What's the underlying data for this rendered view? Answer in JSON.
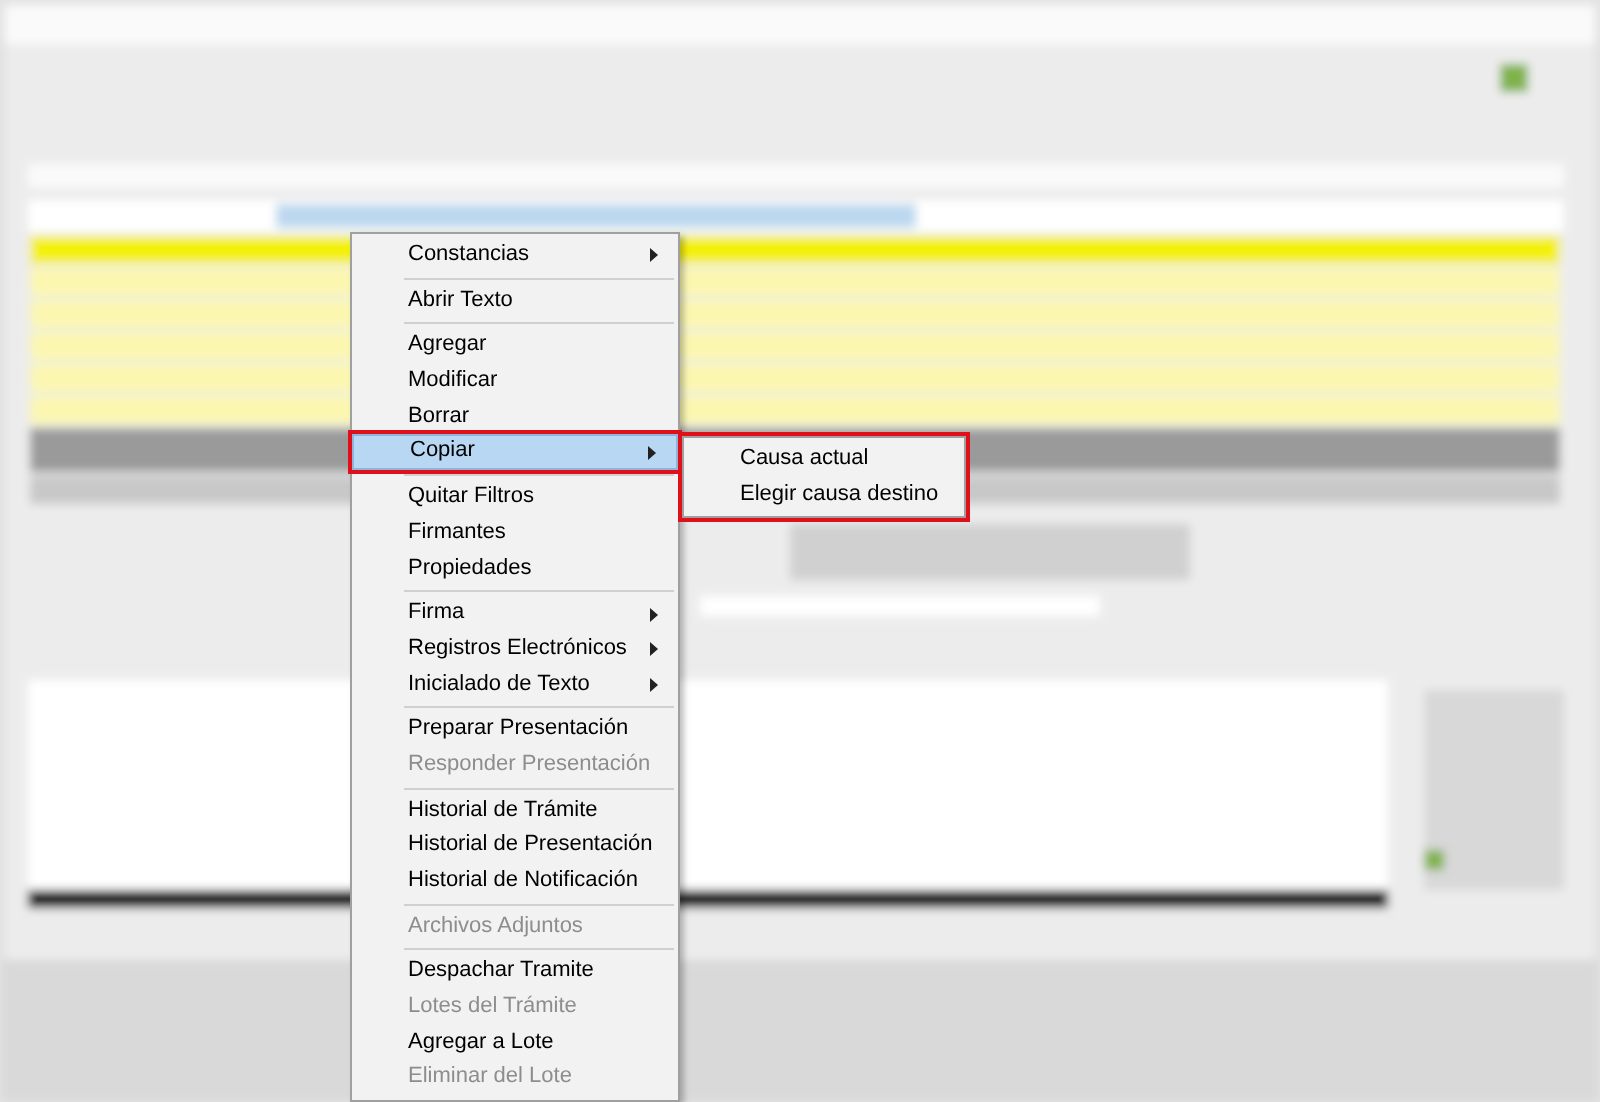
{
  "context_menu": {
    "items": [
      {
        "kind": "item",
        "label": "Constancias",
        "has_submenu": true,
        "disabled": false,
        "selected": false
      },
      {
        "kind": "separator"
      },
      {
        "kind": "item",
        "label": "Abrir Texto",
        "has_submenu": false,
        "disabled": false,
        "selected": false
      },
      {
        "kind": "separator"
      },
      {
        "kind": "item",
        "label": "Agregar",
        "has_submenu": false,
        "disabled": false,
        "selected": false
      },
      {
        "kind": "item",
        "label": "Modificar",
        "has_submenu": false,
        "disabled": false,
        "selected": false
      },
      {
        "kind": "item",
        "label": "Borrar",
        "has_submenu": false,
        "disabled": false,
        "selected": false
      },
      {
        "kind": "item",
        "label": "Copiar",
        "has_submenu": true,
        "disabled": false,
        "selected": true,
        "outlined": true
      },
      {
        "kind": "separator"
      },
      {
        "kind": "item",
        "label": "Quitar Filtros",
        "has_submenu": false,
        "disabled": false,
        "selected": false
      },
      {
        "kind": "item",
        "label": "Firmantes",
        "has_submenu": false,
        "disabled": false,
        "selected": false
      },
      {
        "kind": "item",
        "label": "Propiedades",
        "has_submenu": false,
        "disabled": false,
        "selected": false
      },
      {
        "kind": "separator"
      },
      {
        "kind": "item",
        "label": "Firma",
        "has_submenu": true,
        "disabled": false,
        "selected": false
      },
      {
        "kind": "item",
        "label": "Registros Electrónicos",
        "has_submenu": true,
        "disabled": false,
        "selected": false
      },
      {
        "kind": "item",
        "label": "Inicialado de Texto",
        "has_submenu": true,
        "disabled": false,
        "selected": false
      },
      {
        "kind": "separator"
      },
      {
        "kind": "item",
        "label": "Preparar Presentación",
        "has_submenu": false,
        "disabled": false,
        "selected": false
      },
      {
        "kind": "item",
        "label": "Responder Presentación",
        "has_submenu": false,
        "disabled": true,
        "selected": false
      },
      {
        "kind": "separator"
      },
      {
        "kind": "item",
        "label": "Historial de Trámite",
        "has_submenu": false,
        "disabled": false,
        "selected": false
      },
      {
        "kind": "item",
        "label": "Historial de Presentación",
        "has_submenu": false,
        "disabled": false,
        "selected": false
      },
      {
        "kind": "item",
        "label": "Historial de Notificación",
        "has_submenu": false,
        "disabled": false,
        "selected": false
      },
      {
        "kind": "separator"
      },
      {
        "kind": "item",
        "label": "Archivos Adjuntos",
        "has_submenu": false,
        "disabled": true,
        "selected": false
      },
      {
        "kind": "separator"
      },
      {
        "kind": "item",
        "label": "Despachar Tramite",
        "has_submenu": false,
        "disabled": false,
        "selected": false
      },
      {
        "kind": "item",
        "label": "Lotes del Trámite",
        "has_submenu": false,
        "disabled": true,
        "selected": false
      },
      {
        "kind": "item",
        "label": "Agregar a Lote",
        "has_submenu": false,
        "disabled": false,
        "selected": false
      },
      {
        "kind": "item",
        "label": "Eliminar del Lote",
        "has_submenu": false,
        "disabled": true,
        "selected": false
      }
    ]
  },
  "submenu": {
    "outlined": true,
    "items": [
      {
        "label": "Causa actual",
        "disabled": false
      },
      {
        "label": "Elegir causa destino",
        "disabled": false
      }
    ]
  }
}
